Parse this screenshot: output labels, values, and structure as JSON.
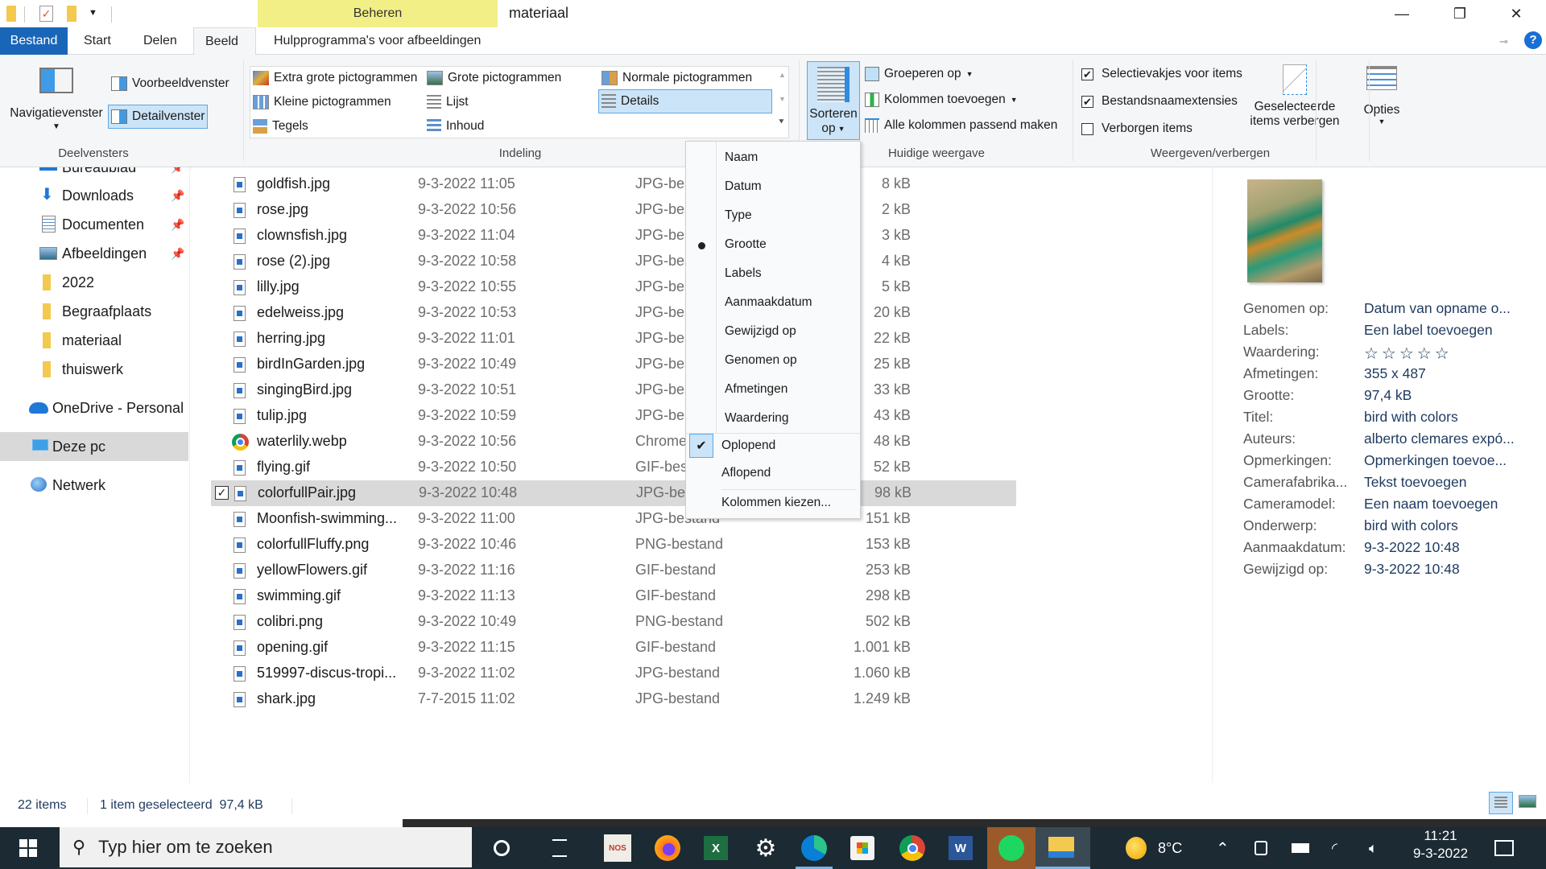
{
  "window": {
    "title": "materiaal",
    "contextual_group": "Beheren",
    "controls": {
      "minimize": "—",
      "maximize": "❐",
      "close": "✕"
    },
    "help": "?"
  },
  "tabs": [
    {
      "label": "Bestand"
    },
    {
      "label": "Start"
    },
    {
      "label": "Delen"
    },
    {
      "label": "Beeld",
      "active": true
    },
    {
      "label": "Hulpprogramma's voor afbeeldingen"
    }
  ],
  "ribbon": {
    "panes": {
      "label": "Deelvensters",
      "navigation_pane": "Navigatievenster",
      "preview_pane": "Voorbeeldvenster",
      "details_pane": "Detailvenster"
    },
    "layout": {
      "label": "Indeling",
      "options": [
        {
          "label": "Extra grote pictogrammen"
        },
        {
          "label": "Grote pictogrammen"
        },
        {
          "label": "Normale pictogrammen"
        },
        {
          "label": "Kleine pictogrammen"
        },
        {
          "label": "Lijst"
        },
        {
          "label": "Details",
          "selected": true
        },
        {
          "label": "Tegels"
        },
        {
          "label": "Inhoud"
        }
      ]
    },
    "current_view": {
      "label": "Huidige weergave",
      "sort_by_line1": "Sorteren",
      "sort_by_line2": "op",
      "group_by": "Groeperen op",
      "add_columns": "Kolommen toevoegen",
      "size_all_columns": "Alle kolommen passend maken"
    },
    "show_hide": {
      "label": "Weergeven/verbergen",
      "item_checkboxes": {
        "label": "Selectievakjes voor items",
        "checked": true
      },
      "file_extensions": {
        "label": "Bestandsnaamextensies",
        "checked": true
      },
      "hidden_items": {
        "label": "Verborgen items",
        "checked": false
      },
      "hide_selected_line1": "Geselecteerde",
      "hide_selected_line2": "items verbergen"
    },
    "options": {
      "label": "Opties"
    }
  },
  "nav": {
    "items": [
      {
        "label": "Bureaublad",
        "pinned": true
      },
      {
        "label": "Downloads",
        "pinned": true
      },
      {
        "label": "Documenten",
        "pinned": true
      },
      {
        "label": "Afbeeldingen",
        "pinned": true
      },
      {
        "label": "2022"
      },
      {
        "label": "Begraafplaats"
      },
      {
        "label": "materiaal"
      },
      {
        "label": "thuiswerk"
      },
      {
        "label": "OneDrive - Personal"
      },
      {
        "label": "Deze pc",
        "selected": true
      },
      {
        "label": "Netwerk"
      }
    ]
  },
  "files": [
    {
      "name": "goldfish.jpg",
      "date": "9-3-2022 11:05",
      "type": "JPG-bes",
      "size": "8 kB"
    },
    {
      "name": "rose.jpg",
      "date": "9-3-2022 10:56",
      "type": "JPG-bes",
      "size": "2 kB"
    },
    {
      "name": "clownsfish.jpg",
      "date": "9-3-2022 11:04",
      "type": "JPG-bes",
      "size": "3 kB"
    },
    {
      "name": "rose (2).jpg",
      "date": "9-3-2022 10:58",
      "type": "JPG-bes",
      "size": "4 kB"
    },
    {
      "name": "lilly.jpg",
      "date": "9-3-2022 10:55",
      "type": "JPG-bes",
      "size": "5 kB"
    },
    {
      "name": "edelweiss.jpg",
      "date": "9-3-2022 10:53",
      "type": "JPG-bes",
      "size": "20 kB"
    },
    {
      "name": "herring.jpg",
      "date": "9-3-2022 11:01",
      "type": "JPG-bes",
      "size": "22 kB"
    },
    {
      "name": "birdInGarden.jpg",
      "date": "9-3-2022 10:49",
      "type": "JPG-bes",
      "size": "25 kB"
    },
    {
      "name": "singingBird.jpg",
      "date": "9-3-2022 10:51",
      "type": "JPG-bes",
      "size": "33 kB"
    },
    {
      "name": "tulip.jpg",
      "date": "9-3-2022 10:59",
      "type": "JPG-bes",
      "size": "43 kB"
    },
    {
      "name": "waterlily.webp",
      "date": "9-3-2022 10:56",
      "type": "Chrome",
      "size": "48 kB",
      "icon": "chrome"
    },
    {
      "name": "flying.gif",
      "date": "9-3-2022 10:50",
      "type": "GIF-bes",
      "size": "52 kB"
    },
    {
      "name": "colorfullPair.jpg",
      "date": "9-3-2022 10:48",
      "type": "JPG-bes",
      "size": "98 kB",
      "selected": true
    },
    {
      "name": "Moonfish-swimming...",
      "date": "9-3-2022 11:00",
      "type": "JPG-bestand",
      "size": "151 kB"
    },
    {
      "name": "colorfullFluffy.png",
      "date": "9-3-2022 10:46",
      "type": "PNG-bestand",
      "size": "153 kB"
    },
    {
      "name": "yellowFlowers.gif",
      "date": "9-3-2022 11:16",
      "type": "GIF-bestand",
      "size": "253 kB"
    },
    {
      "name": "swimming.gif",
      "date": "9-3-2022 11:13",
      "type": "GIF-bestand",
      "size": "298 kB"
    },
    {
      "name": "colibri.png",
      "date": "9-3-2022 10:49",
      "type": "PNG-bestand",
      "size": "502 kB"
    },
    {
      "name": "opening.gif",
      "date": "9-3-2022 11:15",
      "type": "GIF-bestand",
      "size": "1.001 kB"
    },
    {
      "name": "519997-discus-tropi...",
      "date": "9-3-2022 11:02",
      "type": "JPG-bestand",
      "size": "1.060 kB"
    },
    {
      "name": "shark.jpg",
      "date": "7-7-2015 11:02",
      "type": "JPG-bestand",
      "size": "1.249 kB"
    }
  ],
  "sort_menu": {
    "fields": [
      {
        "label": "Naam"
      },
      {
        "label": "Datum"
      },
      {
        "label": "Type"
      },
      {
        "label": "Grootte",
        "selected": true
      },
      {
        "label": "Labels"
      },
      {
        "label": "Aanmaakdatum"
      },
      {
        "label": "Gewijzigd op"
      },
      {
        "label": "Genomen op"
      },
      {
        "label": "Afmetingen"
      },
      {
        "label": "Waardering"
      }
    ],
    "ascending": {
      "label": "Oplopend",
      "checked": true
    },
    "descending": {
      "label": "Aflopend"
    },
    "choose_columns": "Kolommen kiezen..."
  },
  "details": {
    "properties": [
      {
        "key": "Genomen op:",
        "value": "Datum van opname o..."
      },
      {
        "key": "Labels:",
        "value": "Een label toevoegen"
      },
      {
        "key": "Waardering:",
        "value": "☆☆☆☆☆",
        "rating": 0
      },
      {
        "key": "Afmetingen:",
        "value": "355 x 487"
      },
      {
        "key": "Grootte:",
        "value": "97,4 kB"
      },
      {
        "key": "Titel:",
        "value": "bird with colors"
      },
      {
        "key": "Auteurs:",
        "value": "alberto clemares expó..."
      },
      {
        "key": "Opmerkingen:",
        "value": "Opmerkingen toevoe..."
      },
      {
        "key": "Camerafabrika...",
        "value": "Tekst toevoegen"
      },
      {
        "key": "Cameramodel:",
        "value": "Een naam toevoegen"
      },
      {
        "key": "Onderwerp:",
        "value": "bird with colors"
      },
      {
        "key": "Aanmaakdatum:",
        "value": "9-3-2022 10:48"
      },
      {
        "key": "Gewijzigd op:",
        "value": "9-3-2022 10:48"
      }
    ]
  },
  "status": {
    "item_count": "22 items",
    "selection": "1 item geselecteerd  97,4 kB"
  },
  "taskbar": {
    "search_placeholder": "Typ hier om te zoeken",
    "apps": [
      "cortana",
      "task-view",
      "nos",
      "firefox",
      "excel",
      "settings",
      "edge",
      "store",
      "chrome",
      "word",
      "spotify",
      "file-explorer"
    ],
    "nos_label": "NOS",
    "weather": "8°C",
    "time": "11:21",
    "date": "9-3-2022"
  }
}
